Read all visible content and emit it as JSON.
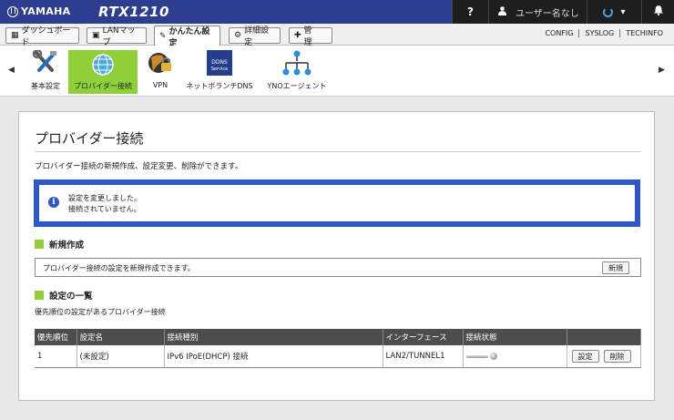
{
  "header": {
    "brand": "YAMAHA",
    "model": "RTX1210",
    "help_icon": "?",
    "user_label": "ユーザー名なし",
    "colors": {
      "header_bg": "#2d3e8e",
      "accent_green": "#8fd03a",
      "info_border": "#2b57c9"
    }
  },
  "tabs": [
    {
      "label": "ダッシュボード",
      "icon": "dashboard-icon"
    },
    {
      "label": "LANマップ",
      "icon": "lan-map-icon"
    },
    {
      "label": "かんたん設定",
      "icon": "wizard-icon"
    },
    {
      "label": "詳細設定",
      "icon": "gear-icon"
    },
    {
      "label": "管　理",
      "icon": "wrench-icon"
    }
  ],
  "top_links": [
    "CONFIG",
    "SYSLOG",
    "TECHINFO"
  ],
  "menu": [
    {
      "label": "基本設定",
      "icon": "tools-icon"
    },
    {
      "label": "プロバイダー接続",
      "icon": "globe-icon"
    },
    {
      "label": "VPN",
      "icon": "vpn-lock-icon"
    },
    {
      "label": "ネットボランチDNS",
      "icon": "ddns-service-icon"
    },
    {
      "label": "YNOエージェント",
      "icon": "yno-network-icon"
    }
  ],
  "page": {
    "title": "プロバイダー接続",
    "description": "プロバイダー接続の新規作成、設定変更、削除ができます。",
    "info_line1": "設定を変更しました。",
    "info_line2": "接続されていません。",
    "section_new_title": "新規作成",
    "section_new_text": "プロバイダー接続の設定を新規作成できます。",
    "new_button": "新規",
    "section_list_title": "設定の一覧",
    "list_subtitle": "優先順位の設定があるプロバイダー接続"
  },
  "table": {
    "headers": [
      "優先順位",
      "設定名",
      "接続種別",
      "インターフェース",
      "接続状態",
      ""
    ],
    "rows": [
      {
        "priority": "1",
        "name": "(未設定)",
        "type": "IPv6 IPoE(DHCP) 接続",
        "interface": "LAN2/TUNNEL1",
        "edit": "設定",
        "delete": "削除"
      }
    ]
  }
}
